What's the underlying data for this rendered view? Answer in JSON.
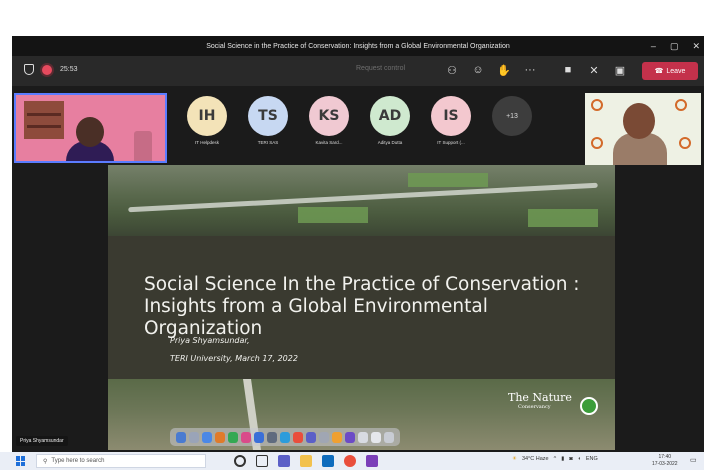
{
  "window": {
    "title": "Social Science in the Practice of Conservation: Insights from a Global Environmental Organization",
    "controls": [
      "–",
      "▢",
      "✕"
    ]
  },
  "toolbar": {
    "timer": "25:53",
    "request_control": "Request control",
    "leave_label": "Leave",
    "leave_color": "#c4314b"
  },
  "participants": [
    {
      "initials": "IH",
      "name": "IT Helpdesk",
      "color": "#f3e3b8"
    },
    {
      "initials": "TS",
      "name": "TERI SAS",
      "color": "#c7d8f2"
    },
    {
      "initials": "KS",
      "name": "Kavita Sard...",
      "color": "#f0c9d2"
    },
    {
      "initials": "AD",
      "name": "Aditya Dutta",
      "color": "#cfe9cf"
    },
    {
      "initials": "IS",
      "name": "IT Support (...",
      "color": "#f3c8cf"
    }
  ],
  "more_participants": "+13",
  "self_name": "Priya Shyamsundar",
  "slide": {
    "title_line1": "Social Science In the Practice of Conservation :",
    "title_line2": "Insights from a Global Environmental Organization",
    "author": "Priya Shyamsundar,",
    "place": "TERI University, March 17, 2022",
    "logo_main": "The Nature",
    "logo_sub": "Conservancy"
  },
  "taskbar": {
    "search_placeholder": "Type here to search",
    "weather": "34°C Haze",
    "lang": "ENG",
    "time": "17:40",
    "date": "17-03-2022"
  }
}
